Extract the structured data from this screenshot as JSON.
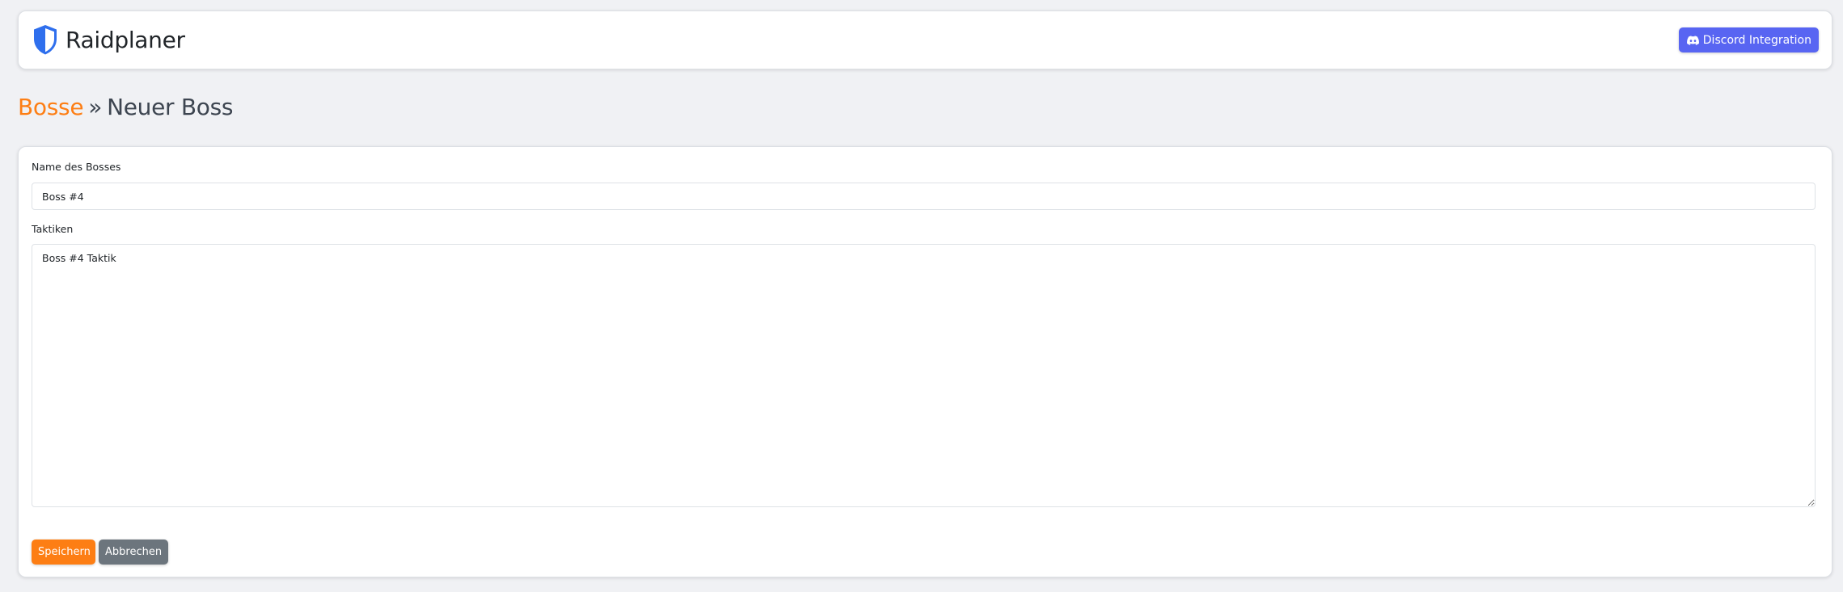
{
  "app": {
    "brand_name": "Raidplaner",
    "brand_icon": "shield-icon"
  },
  "header": {
    "discord_button_label": "Discord Integration",
    "discord_icon": "discord-icon"
  },
  "breadcrumb": {
    "link_label": "Bosse",
    "separator": "»",
    "current": "Neuer Boss"
  },
  "form": {
    "name_label": "Name des Bosses",
    "name_value": "Boss #4",
    "tactics_label": "Taktiken",
    "tactics_value": "Boss #4 Taktik",
    "save_label": "Speichern",
    "cancel_label": "Abbrechen"
  },
  "colors": {
    "accent": "#fd7e14",
    "discord": "#5865f2",
    "shield": "#2f6fed",
    "secondary": "#6c757d",
    "background": "#f0f1f4"
  }
}
